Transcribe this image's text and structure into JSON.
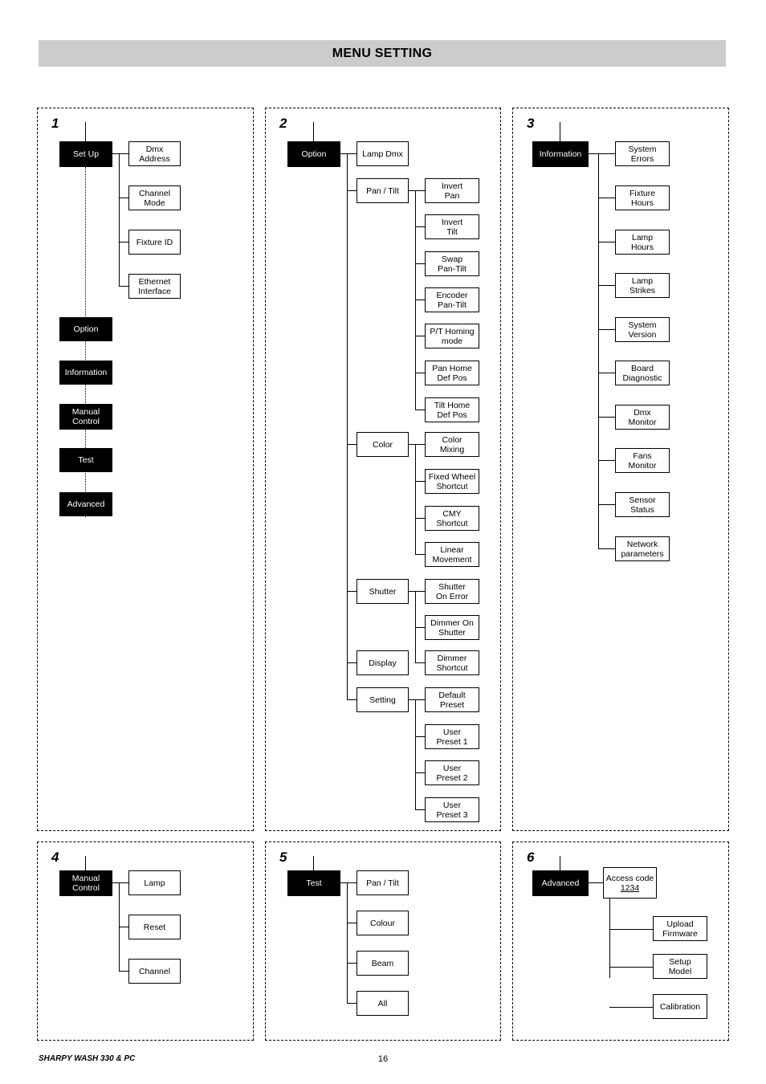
{
  "header": {
    "title": "MENU SETTING"
  },
  "footer": {
    "model": "SHARPY WASH 330 & PC",
    "page": "16"
  },
  "panels": [
    {
      "number": "1",
      "root": "Set Up",
      "main_menu": [
        "Set Up",
        "Option",
        "Information",
        "Manual Control",
        "Test",
        "Advanced"
      ],
      "children": [
        "Dmx\nAddress",
        "Channel\nMode",
        "Fixture ID",
        "Ethernet\nInterface"
      ],
      "sub_nodes": [
        "Option",
        "Information",
        "Manual\nControl",
        "Test",
        "Advanced"
      ]
    },
    {
      "number": "2",
      "root": "Option",
      "children": [
        "Lamp Dmx",
        "Pan / Tilt",
        "Color",
        "Shutter",
        "Display",
        "Setting"
      ],
      "pan_tilt": [
        "Invert\nPan",
        "Invert\nTilt",
        "Swap\nPan-Tilt",
        "Encoder\nPan-Tilt",
        "P/T Homing\nmode",
        "Pan Home\nDef Pos",
        "Tilt Home\nDef Pos"
      ],
      "color": [
        "Color\nMixing",
        "Fixed Wheel\nShortcut",
        "CMY\nShortcut",
        "Linear\nMovement"
      ],
      "shutter": [
        "Shutter\nOn Error",
        "Dimmer On\nShutter",
        "Dimmer\nShortcut"
      ],
      "setting": [
        "Default\nPreset",
        "User\nPreset 1",
        "User\nPreset 2",
        "User\nPreset 3"
      ]
    },
    {
      "number": "3",
      "root": "Information",
      "children": [
        "System\nErrors",
        "Fixture\nHours",
        "Lamp\nHours",
        "Lamp\nStrikes",
        "System\nVersion",
        "Board\nDiagnostic",
        "Dmx\nMonitor",
        "Fans\nMonitor",
        "Sensor\nStatus",
        "Network\nparameters"
      ]
    },
    {
      "number": "4",
      "root": "Manual\nControl",
      "children": [
        "Lamp",
        "Reset",
        "Channel"
      ]
    },
    {
      "number": "5",
      "root": "Test",
      "children": [
        "Pan / Tilt",
        "Colour",
        "Beam",
        "All"
      ]
    },
    {
      "number": "6",
      "root": "Advanced",
      "access_code_label": "Access code",
      "access_code_value": "1234",
      "children": [
        "Upload\nFirmware",
        "Setup\nModel",
        "Calibration"
      ]
    }
  ]
}
